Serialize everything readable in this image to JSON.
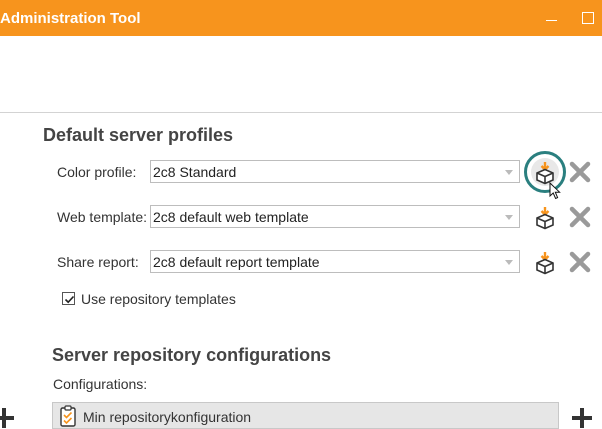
{
  "window": {
    "title": "Administration Tool"
  },
  "default_profiles": {
    "title": "Default server profiles",
    "rows": [
      {
        "label": "Color profile:",
        "value": "2c8 Standard"
      },
      {
        "label": "Web template:",
        "value": "2c8 default web template"
      },
      {
        "label": "Share report:",
        "value": "2c8 default report template"
      }
    ],
    "use_repo_templates": {
      "label": "Use repository templates",
      "checked": true
    }
  },
  "repository": {
    "title": "Server repository configurations",
    "configs_label": "Configurations:",
    "items": [
      {
        "label": "Min repositorykonfiguration"
      }
    ]
  },
  "colors": {
    "accent": "#f7941d",
    "focus": "#2a7f7f",
    "delete": "#9a9a9a"
  },
  "icons": {
    "pick": "package-arrow-icon",
    "remove": "x-delete-icon",
    "add": "plus-icon",
    "config": "clipboard-check-icon"
  }
}
